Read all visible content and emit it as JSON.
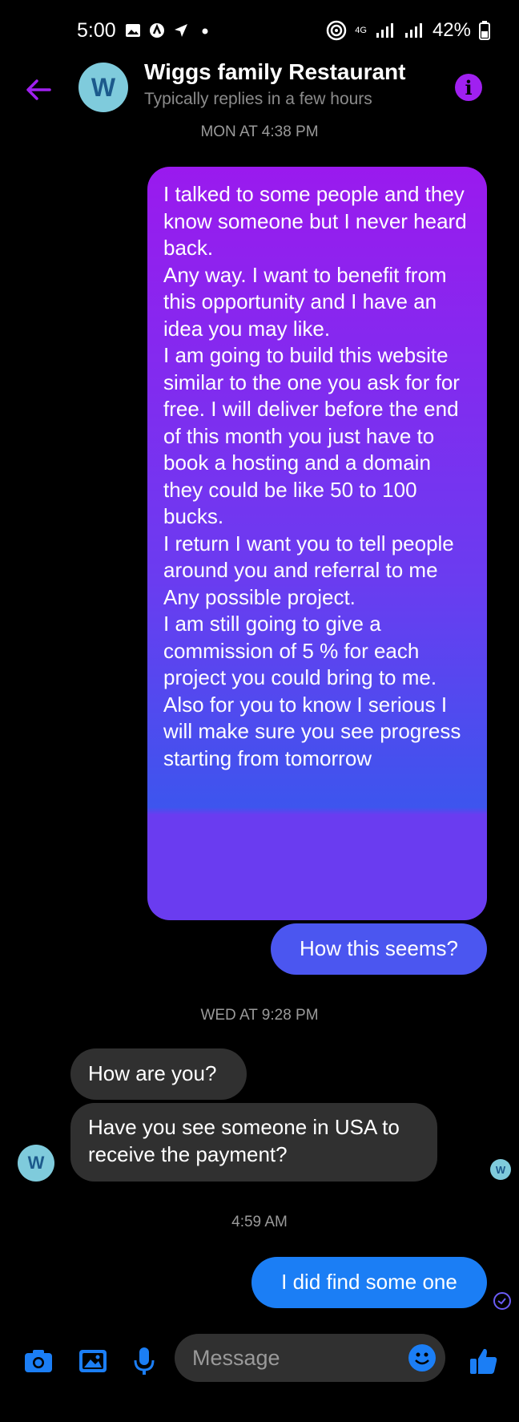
{
  "status": {
    "time": "5:00",
    "network": "4G",
    "battery": "42%"
  },
  "header": {
    "title": "Wiggs family Restaurant",
    "subtitle": "Typically replies in a few hours",
    "avatar_letter": "W",
    "info_glyph": "i"
  },
  "messages": {
    "ts1": "MON AT 4:38 PM",
    "out1": "I talked to some people and they know someone but I never heard back.\nAny way. I want to benefit from this opportunity and I have an idea you may like.\nI am going to build this website similar to the one you ask for for free. I will deliver before the end of this month you just have to book a hosting and a domain they could be like 50 to 100 bucks.\nI return I want you to tell people around you and referral to me Any possible project.\n I am still going to give a commission of 5 % for each project you could bring to me.\nAlso for you to know I serious I will make sure you see progress starting from tomorrow",
    "out2": "How this seems?",
    "ts2": "WED AT 9:28 PM",
    "in1": "How are you?",
    "in2": "Have you see someone in USA to receive the payment?",
    "ts3": "4:59 AM",
    "out3": "I did find some one"
  },
  "composer": {
    "placeholder": "Message"
  },
  "colors": {
    "accent": "#a020f0",
    "outgoing_blue": "#1b7ef5",
    "incoming": "#303030"
  }
}
